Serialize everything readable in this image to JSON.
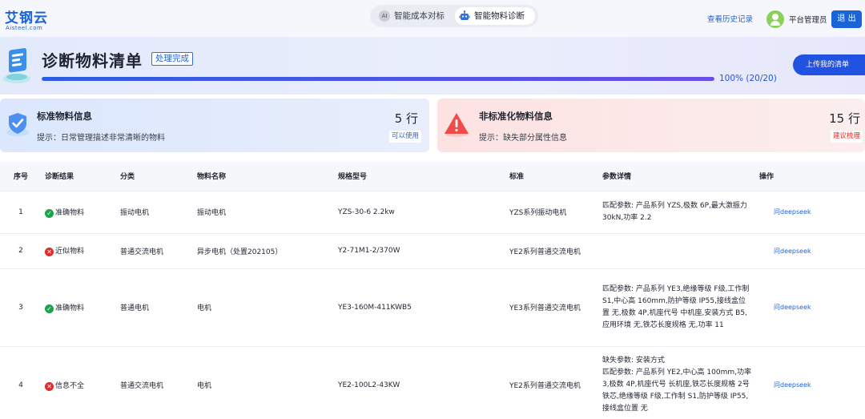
{
  "logo": {
    "cn": "艾钢云",
    "en": "Aisteel.com"
  },
  "tabs": [
    {
      "label": "智能成本对标",
      "icon": "ai-icon",
      "active": false
    },
    {
      "label": "智能物料诊断",
      "icon": "robot-icon",
      "active": true
    }
  ],
  "header": {
    "history_link": "查看历史记录",
    "username": "平台管理员",
    "logout_label": "退 出"
  },
  "page": {
    "title": "诊断物料清单",
    "status": "处理完成",
    "upload_label": "上传我的清单",
    "progress": {
      "percent": 100,
      "text": "100% (20/20)"
    }
  },
  "cards": {
    "standard": {
      "title": "标准物料信息",
      "hint": "提示：日常管理描述非常清晰的物料",
      "count": "5 行",
      "tag": "可以使用"
    },
    "nonstandard": {
      "title": "非标准化物料信息",
      "hint": "提示：缺失部分属性信息",
      "count": "15 行",
      "tag": "建议梳理"
    }
  },
  "table": {
    "headers": [
      "序号",
      "诊断结果",
      "分类",
      "物料名称",
      "规格型号",
      "标准",
      "参数详情",
      "操作"
    ],
    "rows": [
      {
        "no": "1",
        "result": "准确物料",
        "result_type": "ok",
        "category": "振动电机",
        "name": "振动电机",
        "spec": "YZS-30-6 2.2kw",
        "standard": "YZS系列振动电机",
        "params": "匹配参数: 产品系列 YZS,极数 6P,最大激振力 30kN,功率 2.2",
        "action": "问deepseek"
      },
      {
        "no": "2",
        "result": "近似物料",
        "result_type": "bad",
        "category": "普通交流电机",
        "name": "异步电机（处置202105）",
        "spec": "Y2-71M1-2/370W",
        "standard": "YE2系列普通交流电机",
        "params": "",
        "action": "问deepseek"
      },
      {
        "no": "3",
        "result": "准确物料",
        "result_type": "ok",
        "category": "普通电机",
        "name": "电机",
        "spec": "YE3-160M-411KWB5",
        "standard": "YE3系列普通交流电机",
        "params": "匹配参数: 产品系列 YE3,绝缘等级 F级,工作制 S1,中心高 160mm,防护等级 IP55,接线盒位置 无,极数 4P,机座代号 中机座,安装方式 B5,应用环境 无,铁芯长度规格 无,功率 11",
        "action": "问deepseek"
      },
      {
        "no": "4",
        "result": "信息不全",
        "result_type": "bad",
        "category": "普通交流电机",
        "name": "电机",
        "spec": "YE2-100L2-43KW",
        "standard": "YE2系列普通交流电机",
        "params": "缺失参数: 安装方式\n匹配参数: 产品系列 YE2,中心高 100mm,功率 3,极数 4P,机座代号 长机座,铁芯长度规格 2号铁芯,绝缘等级 F级,工作制 S1,防护等级 IP55,接线盒位置 无",
        "action": "问deepseek"
      }
    ]
  },
  "colors": {
    "primary": "#1b63d9",
    "success": "#1aa34a",
    "danger": "#e02b2b",
    "progress_end": "#6a4de6"
  }
}
